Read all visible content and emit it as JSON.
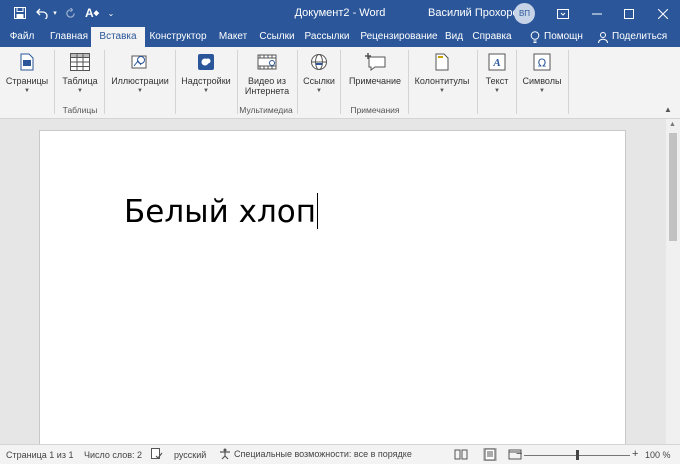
{
  "titlebar": {
    "doc_title": "Документ2  -  Word",
    "user_name": "Василий Прохоров",
    "user_initials": "ВП"
  },
  "tabs": [
    {
      "label": "Файл",
      "active": false
    },
    {
      "label": "Главная",
      "active": false
    },
    {
      "label": "Вставка",
      "active": true
    },
    {
      "label": "Конструктор",
      "active": false
    },
    {
      "label": "Макет",
      "active": false
    },
    {
      "label": "Ссылки",
      "active": false
    },
    {
      "label": "Рассылки",
      "active": false
    },
    {
      "label": "Рецензирование",
      "active": false
    },
    {
      "label": "Вид",
      "active": false
    },
    {
      "label": "Справка",
      "active": false
    }
  ],
  "tab_right": {
    "help_label": "Помощн",
    "share_label": "Поделиться"
  },
  "ribbon": {
    "buttons": {
      "pages": "Страницы",
      "table": "Таблица",
      "illustrations": "Иллюстрации",
      "addins": "Надстройки",
      "video_line1": "Видео из",
      "video_line2": "Интернета",
      "links": "Ссылки",
      "comment": "Примечание",
      "header_footer": "Колонтитулы",
      "text": "Текст",
      "symbols": "Символы"
    },
    "groups": {
      "tables": "Таблицы",
      "media": "Мультимедиа",
      "comments": "Примечания"
    }
  },
  "document": {
    "text": "Белый хлоп"
  },
  "statusbar": {
    "page": "Страница 1 из 1",
    "words": "Число слов: 2",
    "language": "русский",
    "accessibility": "Специальные возможности: все в порядке",
    "zoom": "100 %"
  },
  "colors": {
    "accent": "#2b579a",
    "ribbon_bg": "#f3f3f3",
    "doc_bg": "#e6e6e6"
  }
}
